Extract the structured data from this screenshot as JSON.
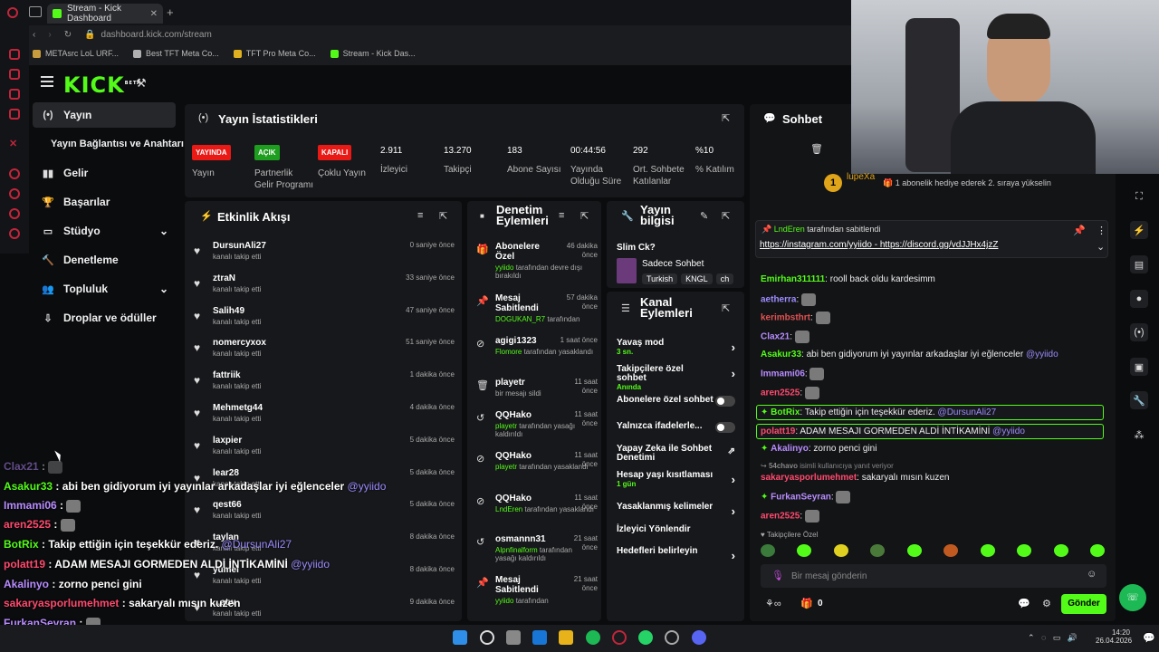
{
  "browser": {
    "tab_title": "Stream - Kick Dashboard",
    "url": "dashboard.kick.com/stream",
    "bookmarks": [
      "METAsrc LoL URF...",
      "Best TFT Meta Co...",
      "TFT Pro Meta Co...",
      "Stream - Kick Das..."
    ]
  },
  "logo": {
    "text": "KICK",
    "beta": "BETA"
  },
  "sidebar": {
    "items": [
      {
        "label": "Yayın",
        "icon": "broadcast-icon"
      },
      {
        "label": "Yayın Bağlantısı ve Anahtarı",
        "icon": ""
      },
      {
        "label": "Gelir",
        "icon": "chart-icon"
      },
      {
        "label": "Başarılar",
        "icon": "trophy-icon"
      },
      {
        "label": "Stüdyo",
        "icon": "studio-icon"
      },
      {
        "label": "Denetleme",
        "icon": "hammer-icon"
      },
      {
        "label": "Topluluk",
        "icon": "people-icon"
      },
      {
        "label": "Droplar ve ödüller",
        "icon": "drops-icon"
      }
    ]
  },
  "stats": {
    "title": "Yayın İstatistikleri",
    "items": [
      {
        "badge": "YAYINDA",
        "badge_color": "#e91916",
        "label": "Yayın"
      },
      {
        "badge": "AÇIK",
        "badge_color": "#1e9e1e",
        "label": "Partnerlik Gelir Programı"
      },
      {
        "badge": "KAPALI",
        "badge_color": "#e91916",
        "label": "Çoklu Yayın"
      },
      {
        "value": "2.911",
        "label": "İzleyici"
      },
      {
        "value": "13.270",
        "label": "Takipçi"
      },
      {
        "value": "183",
        "label": "Abone Sayısı"
      },
      {
        "value": "00:44:56",
        "label": "Yayında Olduğu Süre"
      },
      {
        "value": "292",
        "label": "Ort. Sohbete Katılanlar"
      },
      {
        "value": "%10",
        "label": "% Katılım"
      }
    ]
  },
  "events": {
    "title": "Etkinlik Akışı",
    "items": [
      {
        "name": "DursunAli27",
        "sub": "kanalı takip etti",
        "time": "0 saniye önce"
      },
      {
        "name": "ztraN",
        "sub": "kanalı takip etti",
        "time": "33 saniye önce"
      },
      {
        "name": "Salih49",
        "sub": "kanalı takip etti",
        "time": "47 saniye önce"
      },
      {
        "name": "nomercyxox",
        "sub": "kanalı takip etti",
        "time": "51 saniye önce"
      },
      {
        "name": "fattriik",
        "sub": "kanalı takip etti",
        "time": "1 dakika önce"
      },
      {
        "name": "Mehmetg44",
        "sub": "kanalı takip etti",
        "time": "4 dakika önce"
      },
      {
        "name": "laxpier",
        "sub": "kanalı takip etti",
        "time": "5 dakika önce"
      },
      {
        "name": "lear28",
        "sub": "kanalı takip etti",
        "time": "5 dakika önce"
      },
      {
        "name": "qest66",
        "sub": "kanalı takip etti",
        "time": "5 dakika önce"
      },
      {
        "name": "taylan",
        "sub": "kanalı takip etti",
        "time": "8 dakika önce"
      },
      {
        "name": "yumei",
        "sub": "kanalı takip etti",
        "time": "8 dakika önce"
      },
      {
        "name": "...atw",
        "sub": "kanalı takip etti",
        "time": "9 dakika önce"
      }
    ]
  },
  "moderation": {
    "title": "Denetim Eylemleri",
    "items": [
      {
        "icon": "🎁",
        "title": "Abonelere Özel",
        "who": "yyiido",
        "desc": "tarafından devre dışı bırakıldı",
        "time": "46 dakika önce"
      },
      {
        "icon": "📌",
        "title": "Mesaj Sabitlendi",
        "who": "DOGUKAN_R7",
        "desc": "tarafından",
        "time": "57 dakika önce"
      },
      {
        "icon": "⊘",
        "title": "agigi1323",
        "who": "Flomore",
        "desc": "tarafından yasaklandı",
        "time": "1 saat önce"
      },
      {
        "icon": "🗑",
        "title": "playetr",
        "who": "",
        "desc": "bir mesajı sildi",
        "time": "11 saat önce"
      },
      {
        "icon": "↺",
        "title": "QQHako",
        "who": "playetr",
        "desc": "tarafından yasağı kaldırıldı",
        "time": "11 saat önce"
      },
      {
        "icon": "⊘",
        "title": "QQHako",
        "who": "playetr",
        "desc": "tarafından yasaklandı",
        "time": "11 saat önce"
      },
      {
        "icon": "⊘",
        "title": "QQHako",
        "who": "LndEren",
        "desc": "tarafından yasaklandı",
        "time": "11 saat önce"
      },
      {
        "icon": "↺",
        "title": "osmannn31",
        "who": "Alpnfinalform",
        "desc": "tarafından yasağı kaldırıldı",
        "time": "21 saat önce"
      },
      {
        "icon": "📌",
        "title": "Mesaj Sabitlendi",
        "who": "yyiido",
        "desc": "tarafından",
        "time": "21 saat önce"
      }
    ]
  },
  "stream_info": {
    "title": "Yayın bilgisi",
    "stream_title": "Slim Ck?",
    "category": "Sadece Sohbet",
    "tags": [
      "Turkish",
      "KNGL",
      "ch"
    ]
  },
  "channel": {
    "title": "Kanal Eylemleri",
    "items": [
      {
        "label": "Yavaş mod",
        "sub": "3 sn.",
        "ctrl": "arrow"
      },
      {
        "label": "Takipçilere özel sohbet",
        "sub": "Anında",
        "ctrl": "arrow"
      },
      {
        "label": "Abonelere özel sohbet",
        "sub": "",
        "ctrl": "toggle"
      },
      {
        "label": "Yalnızca ifadelerle...",
        "sub": "",
        "ctrl": "toggle"
      },
      {
        "label": "Yapay Zeka ile Sohbet Denetimi",
        "sub": "",
        "ctrl": "external"
      },
      {
        "label": "Hesap yaşı kısıtlaması",
        "sub": "1 gün",
        "ctrl": "arrow"
      },
      {
        "label": "Yasaklanmış kelimeler",
        "sub": "",
        "ctrl": "arrow"
      },
      {
        "label": "İzleyici Yönlendir",
        "sub": "",
        "ctrl": "none"
      },
      {
        "label": "Hedefleri belirleyin",
        "sub": "",
        "ctrl": "arrow"
      }
    ]
  },
  "chat": {
    "title": "Sohbet",
    "gift_banner": {
      "user": "lupeXa",
      "count": "1",
      "text": "1 abonelik hediye ederek 2. sıraya yükselin"
    },
    "pinned": {
      "by": "LndEren",
      "by_suffix": "tarafından sabitlendi",
      "text": "https://instagram.com/yyiido - https://discord.gg/vdJJHx4jzZ"
    },
    "messages": [
      {
        "user": "Emirhan311111",
        "color": "#53fc18",
        "text": "rooll back oldu kardesimm"
      },
      {
        "user": "aetherra",
        "color": "#9b8cff",
        "text": "",
        "emote": true
      },
      {
        "user": "kerimbsthrt",
        "color": "#e05252",
        "text": "",
        "emote": true
      },
      {
        "user": "Clax21",
        "color": "#b88cff",
        "text": "",
        "emote": true
      },
      {
        "user": "Asakur33",
        "color": "#53fc18",
        "text": "abi ben gidiyorum iyi yayınlar arkadaşlar iyi eğlenceler",
        "mention": "@yyiido"
      },
      {
        "user": "Immami06",
        "color": "#b88cff",
        "text": "",
        "emote": true
      },
      {
        "user": "aren2525",
        "color": "#ff4a6e",
        "text": "",
        "emote": true
      },
      {
        "user": "BotRix",
        "color": "#53fc18",
        "text": "Takip ettiğin için teşekkür ederiz.",
        "mention": "@DursunAli27",
        "highlight": true
      },
      {
        "user": "polatt19",
        "color": "#ff4a6e",
        "text": "ADAM MESAJI GORMEDEN ALDİ İNTİKAMİNİ",
        "mention": "@yyiido",
        "highlight": true
      },
      {
        "user": "Akalinyo",
        "color": "#b88cff",
        "text": "zorno penci gini"
      },
      {
        "user": "54chavo",
        "color": "#888",
        "text": "isimli kullanıcıya yanıt veriyor",
        "reply": true
      },
      {
        "user": "sakaryasporlumehmet",
        "color": "#ff4a6e",
        "text": "sakaryalı mısın kuzen"
      },
      {
        "user": "FurkanSeyran",
        "color": "#b88cff",
        "text": "",
        "emote": true
      },
      {
        "user": "aren2525",
        "color": "#ff4a6e",
        "text": "",
        "emote": true
      }
    ],
    "followers_only": "Takipçilere Özel",
    "input_placeholder": "Bir mesaj gönderin",
    "points": "0",
    "send_label": "Gönder"
  },
  "overlay": {
    "messages": [
      {
        "user": "Clax21",
        "color": "#b88cff",
        "text": ""
      },
      {
        "user": "Asakur33",
        "color": "#53fc18",
        "text": "abi ben gidiyorum iyi yayınlar arkadaşlar iyi eğlenceler",
        "mention": "@yyiido"
      },
      {
        "user": "Immami06",
        "color": "#b88cff",
        "text": ""
      },
      {
        "user": "aren2525",
        "color": "#ff4a6e",
        "text": ""
      },
      {
        "user": "BotRix",
        "color": "#53fc18",
        "text": "Takip ettiğin için teşekkür ederiz.",
        "mention": "@DursunAli27"
      },
      {
        "user": "polatt19",
        "color": "#ff4a6e",
        "text": "ADAM MESAJI GORMEDEN ALDİ İNTİKAMİNİ",
        "mention": "@yyiido"
      },
      {
        "user": "Akalinyo",
        "color": "#b88cff",
        "text": "zorno penci gini"
      },
      {
        "user": "sakaryasporlumehmet",
        "color": "#ff4a6e",
        "text": "sakaryalı mısın kuzen"
      },
      {
        "user": "FurkanSeyran",
        "color": "#b88cff",
        "text": ""
      },
      {
        "user": "aren2525",
        "color": "#ff4a6e",
        "text": ""
      }
    ]
  },
  "taskbar": {
    "time": "14:20",
    "date": "26.04.2026"
  },
  "colors": {
    "accent": "#53fc18",
    "panel": "#17181b",
    "bg": "#0b0c0e"
  }
}
